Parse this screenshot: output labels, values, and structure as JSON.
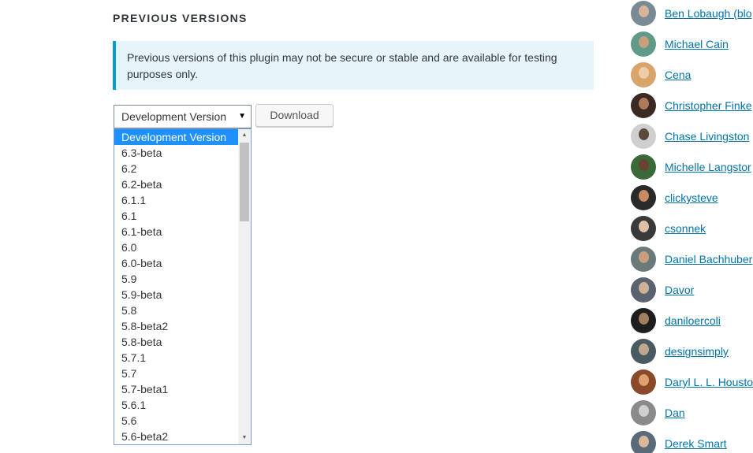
{
  "section": {
    "title": "PREVIOUS VERSIONS",
    "notice": "Previous versions of this plugin may not be secure or stable and are available for testing purposes only."
  },
  "version_select": {
    "selected": "Development Version",
    "arrow_icon": "triangle-down-icon",
    "options": [
      "Development Version",
      "6.3-beta",
      "6.2",
      "6.2-beta",
      "6.1.1",
      "6.1",
      "6.1-beta",
      "6.0",
      "6.0-beta",
      "5.9",
      "5.9-beta",
      "5.8",
      "5.8-beta2",
      "5.8-beta",
      "5.7.1",
      "5.7",
      "5.7-beta1",
      "5.6.1",
      "5.6",
      "5.6-beta2"
    ]
  },
  "download_button": {
    "label": "Download"
  },
  "colors": {
    "link": "#0073aa",
    "notice_bg": "#e5f5fa",
    "notice_border": "#00a0d2",
    "selected_option_bg": "#1e90ff"
  },
  "contributors": [
    {
      "name": "Ben Lobaugh (blo",
      "avatar_bg": "#7a8a94",
      "face": "#d8b49a"
    },
    {
      "name": "Michael Cain",
      "avatar_bg": "#5f9a8a",
      "face": "#c8a07a"
    },
    {
      "name": "Cena",
      "avatar_bg": "#d7a46a",
      "face": "#f0cda8"
    },
    {
      "name": "Christopher Finke",
      "avatar_bg": "#3b2a24",
      "face": "#b07a5a"
    },
    {
      "name": "Chase Livingston",
      "avatar_bg": "#cfcfcf",
      "face": "#5a4a3a"
    },
    {
      "name": "Michelle Langstor",
      "avatar_bg": "#3a6a3a",
      "face": "#6a4230"
    },
    {
      "name": "clickysteve",
      "avatar_bg": "#2a2a2a",
      "face": "#c88a60"
    },
    {
      "name": "csonnek",
      "avatar_bg": "#3a3a3a",
      "face": "#e0c0a8"
    },
    {
      "name": "Daniel Bachhuber",
      "avatar_bg": "#6a7a7a",
      "face": "#c8a080"
    },
    {
      "name": "Davor",
      "avatar_bg": "#5a6470",
      "face": "#d0b098"
    },
    {
      "name": "daniloercoli",
      "avatar_bg": "#1e1e1e",
      "face": "#a08060"
    },
    {
      "name": "designsimply",
      "avatar_bg": "#4a5a62",
      "face": "#c0a890"
    },
    {
      "name": "Daryl L. L. Housto",
      "avatar_bg": "#8a4a2a",
      "face": "#e0a070"
    },
    {
      "name": "Dan",
      "avatar_bg": "#8a8a8a",
      "face": "#d0d0d0"
    },
    {
      "name": "Derek Smart",
      "avatar_bg": "#5a6a7a",
      "face": "#d8b898"
    }
  ]
}
